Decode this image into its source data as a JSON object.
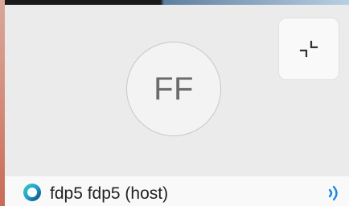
{
  "participant": {
    "initials": "FF",
    "name_label": "fdp5 fdp5 (host)"
  },
  "icons": {
    "collapse": "collapse-arrows-icon",
    "status": "connection-status-icon",
    "audio": "speaker-audio-icon"
  },
  "colors": {
    "accent_blue": "#1e88e5",
    "status_teal": "#2ec4b6",
    "avatar_text": "#6b6b6b"
  }
}
